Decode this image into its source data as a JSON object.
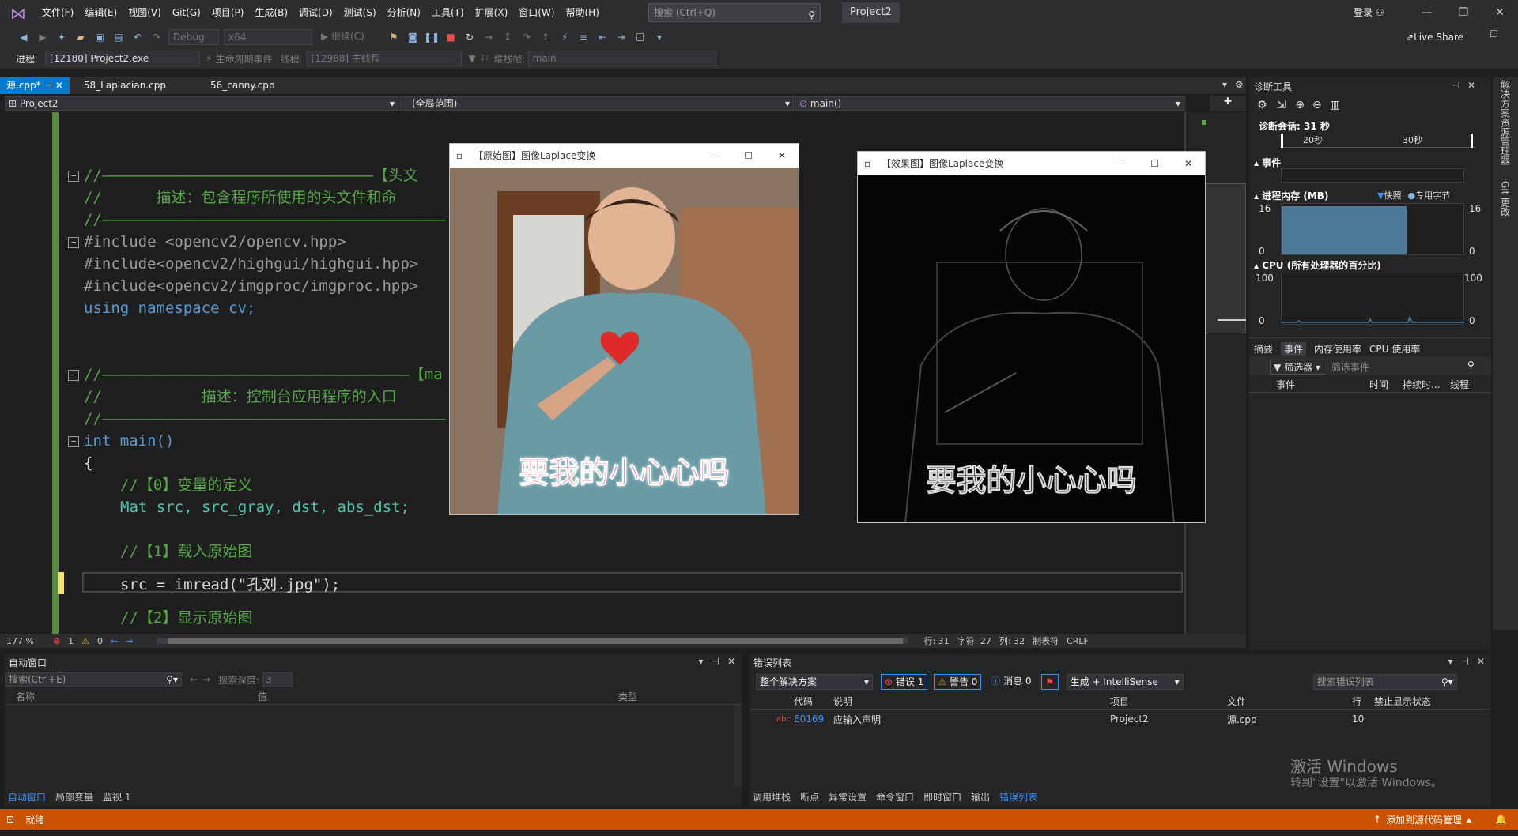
{
  "menu": {
    "items": [
      "文件(F)",
      "编辑(E)",
      "视图(V)",
      "Git(G)",
      "项目(P)",
      "生成(B)",
      "调试(D)",
      "测试(S)",
      "分析(N)",
      "工具(T)",
      "扩展(X)",
      "窗口(W)",
      "帮助(H)"
    ],
    "search_placeholder": "搜索 (Ctrl+Q)",
    "project": "Project2",
    "login": "登录"
  },
  "toolbar": {
    "config": "Debug",
    "platform": "x64",
    "continue": "继续(C)",
    "liveshare": "Live Share"
  },
  "toolbar2": {
    "process_label": "进程:",
    "process_value": "[12180] Project2.exe",
    "lifecycle": "生命周期事件",
    "thread_label": "线程:",
    "thread_value": "[12988] 主线程",
    "stackframe_label": "堆栈帧:",
    "stackframe_value": "main"
  },
  "tabs": [
    "源.cpp*",
    "58_Laplacian.cpp",
    "56_canny.cpp"
  ],
  "navbar": {
    "project": "Project2",
    "scope": "(全局范围)",
    "func": "main()"
  },
  "code": [
    "//——————————————————————————————【头文",
    "//      描述：包含程序所使用的头文件和命",
    "//——————————————————————————————————————",
    "#include <opencv2/opencv.hpp>",
    "#include<opencv2/highgui/highgui.hpp>",
    "#include<opencv2/imgproc/imgproc.hpp>",
    "using namespace cv;",
    "//——————————————————————————————————【ma",
    "//           描述：控制台应用程序的入口",
    "//——————————————————————————————————————",
    "int main()",
    "{",
    "//【0】变量的定义",
    "Mat src, src_gray, dst, abs_dst;",
    "//【1】载入原始图",
    "src = imread(\"孔刘.jpg\");",
    "//【2】显示原始图"
  ],
  "editor_status": {
    "zoom": "177 %",
    "errors": "1",
    "warnings": "0",
    "line": "行: 31",
    "char": "字符: 27",
    "col": "列: 32",
    "tabs": "制表符",
    "eol": "CRLF"
  },
  "cv_original": {
    "title": "【原始图】图像Laplace变换",
    "caption": "要我的小心心吗"
  },
  "cv_effect": {
    "title": "【效果图】图像Laplace变换",
    "caption": "要我的小心心吗"
  },
  "diag": {
    "title": "诊断工具",
    "session": "诊断会话: 31 秒",
    "t1": "20秒",
    "t2": "30秒",
    "events": "事件",
    "memory": "进程内存 (MB)",
    "snapshot": "快照",
    "private": "专用字节",
    "mem_max": "16",
    "mem_min": "0",
    "cpu": "CPU (所有处理器的百分比)",
    "cpu_max": "100",
    "cpu_min": "0",
    "tabs": [
      "摘要",
      "事件",
      "内存使用率",
      "CPU 使用率"
    ],
    "filter": "筛选器",
    "filter_placeholder": "筛选事件",
    "cols": [
      "事件",
      "时间",
      "持续时...",
      "线程"
    ],
    "memory_fill": 0.95
  },
  "autos": {
    "title": "自动窗口",
    "search": "搜索(Ctrl+E)",
    "depth_label": "搜索深度:",
    "depth": "3",
    "cols": [
      "名称",
      "值",
      "类型"
    ],
    "tabs": [
      "自动窗口",
      "局部变量",
      "监视 1"
    ]
  },
  "errors": {
    "title": "错误列表",
    "scope": "整个解决方案",
    "err_btn": "错误 1",
    "warn_btn": "警告 0",
    "msg_btn": "消息 0",
    "build": "生成 + IntelliSense",
    "search": "搜索错误列表",
    "cols": [
      "代码",
      "说明",
      "项目",
      "文件",
      "行",
      "禁止显示状态"
    ],
    "row": {
      "code": "E0169",
      "desc": "应输入声明",
      "project": "Project2",
      "file": "源.cpp",
      "line": "10"
    },
    "tabs": [
      "调用堆栈",
      "断点",
      "异常设置",
      "命令窗口",
      "即时窗口",
      "输出",
      "错误列表"
    ]
  },
  "watermark": {
    "line1": "激活 Windows",
    "line2": "转到\"设置\"以激活 Windows。"
  },
  "status": {
    "ready": "就绪",
    "source": "添加到源代码管理"
  },
  "rightside": {
    "a": "解决方案资源管理器",
    "b": "Git 更改"
  },
  "colors": {
    "accent": "#007acc",
    "statusbar": "#ca5100",
    "comment": "#57a64a",
    "keyword": "#569cd6"
  }
}
